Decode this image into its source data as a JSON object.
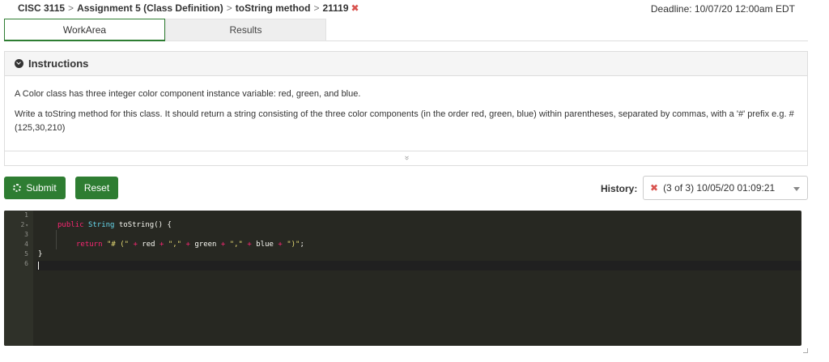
{
  "breadcrumb": {
    "course": "CISC 3115",
    "assignment": "Assignment 5 (Class Definition)",
    "exercise": "toString method",
    "id": "21119",
    "separator": ">",
    "status_mark": "✖"
  },
  "deadline": "Deadline: 10/07/20 12:00am EDT",
  "tabs": [
    {
      "label": "WorkArea",
      "active": true
    },
    {
      "label": "Results",
      "active": false
    }
  ],
  "instructions": {
    "title": "Instructions",
    "paragraphs": [
      "A Color class has three integer color component instance variable: red, green, and blue.",
      "Write a toString method for this class. It should return a string consisting of the three color components (in the order red, green, blue) within parentheses, separated by commas, with a '#' prefix e.g. #(125,30,210)"
    ],
    "expand_glyph": "»"
  },
  "buttons": {
    "submit": "Submit",
    "reset": "Reset"
  },
  "history": {
    "label": "History:",
    "status_mark": "✖",
    "selected": "(3 of 3) 10/05/20 01:09:21"
  },
  "editor": {
    "line_numbers": [
      "1",
      "2",
      "3",
      "4",
      "5",
      "6"
    ],
    "fold_marker": "▾",
    "code": {
      "l2_kw": "public",
      "l2_type": "String",
      "l2_rest": " toString() {",
      "l4_kw": "return",
      "l4_s1": "\"# (\"",
      "l4_op1": "+",
      "l4_v1": "red",
      "l4_op2": "+",
      "l4_s2": "\",\"",
      "l4_op3": "+",
      "l4_v2": "green",
      "l4_op4": "+",
      "l4_s3": "\",\"",
      "l4_op5": "+",
      "l4_v3": "blue",
      "l4_op6": "+",
      "l4_s4": "\")\"",
      "l4_end": ";",
      "l5": "}"
    }
  }
}
